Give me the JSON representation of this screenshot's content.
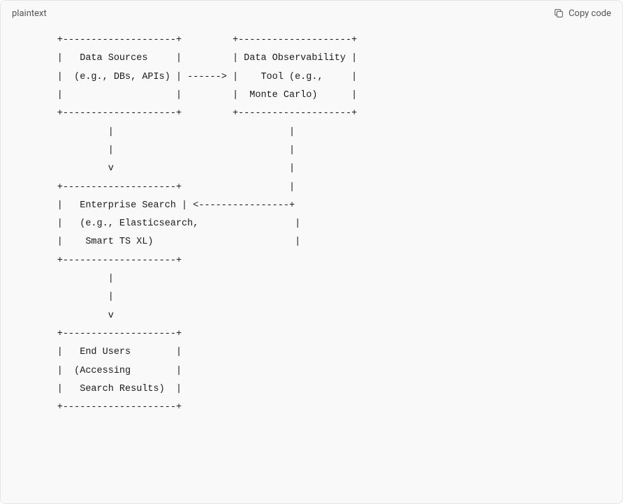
{
  "header": {
    "language": "plaintext",
    "copy_label": "Copy code"
  },
  "diagram": "        +--------------------+         +--------------------+\n        |   Data Sources     |         | Data Observability |\n        |  (e.g., DBs, APIs) | ------> |    Tool (e.g.,     |\n        |                    |         |  Monte Carlo)      |\n        +--------------------+         +--------------------+\n                 |                               |\n                 |                               |\n                 v                               |\n        +--------------------+                   |\n        |   Enterprise Search | <----------------+\n        |   (e.g., Elasticsearch,                 |\n        |    Smart TS XL)                         |\n        +--------------------+\n                 |\n                 |\n                 v\n        +--------------------+\n        |   End Users        |\n        |  (Accessing        |\n        |   Search Results)  |\n        +--------------------+"
}
